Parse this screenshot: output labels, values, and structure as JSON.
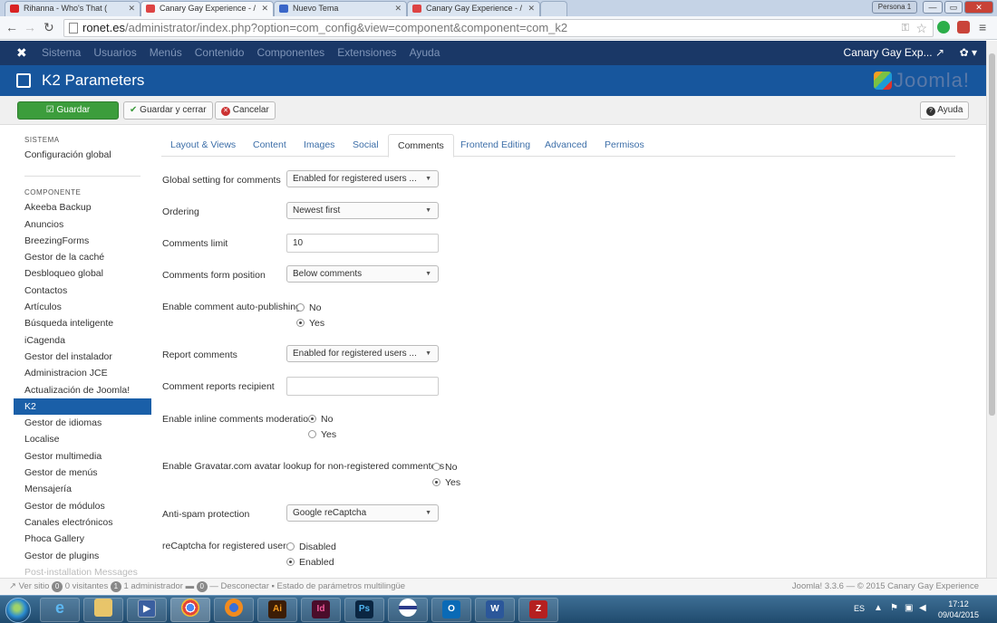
{
  "browser": {
    "tabs": [
      {
        "title": "Rihanna - Who's That (",
        "fav": "#d92323"
      },
      {
        "title": "Canary Gay Experience - /",
        "fav": "#d44"
      },
      {
        "title": "Nuevo Tema",
        "fav": "#3a66c8"
      },
      {
        "title": "Canary Gay Experience - /",
        "fav": "#d44"
      }
    ],
    "persona": "Persona 1",
    "url_domain": "ronet.es",
    "url_path": "/administrator/index.php?option=com_config&view=component&component=com_k2"
  },
  "joomla": {
    "menu": [
      "Sistema",
      "Usuarios",
      "Menús",
      "Contenido",
      "Componentes",
      "Extensiones",
      "Ayuda"
    ],
    "site_name": "Canary Gay Exp...",
    "page_title": "K2 Parameters",
    "logo_text": "Joomla!"
  },
  "toolbar": {
    "save": "Guardar",
    "save_close": "Guardar y cerrar",
    "cancel": "Cancelar",
    "help": "Ayuda"
  },
  "sidebar": {
    "system_header": "SISTEMA",
    "global_config": "Configuración global",
    "component_header": "COMPONENTE",
    "items": [
      "Akeeba Backup",
      "Anuncios",
      "BreezingForms",
      "Gestor de la caché",
      "Desbloqueo global",
      "Contactos",
      "Artículos",
      "Búsqueda inteligente",
      "iCagenda",
      "Gestor del instalador",
      "Administracion JCE",
      "Actualización de Joomla!",
      "K2",
      "Gestor de idiomas",
      "Localise",
      "Gestor multimedia",
      "Gestor de menús",
      "Mensajería",
      "Gestor de módulos",
      "Canales electrónicos",
      "Phoca Gallery",
      "Gestor de plugins",
      "Post-installation Messages"
    ],
    "active_item": "K2"
  },
  "tabs": [
    "Layout & Views",
    "Content",
    "Images",
    "Social",
    "Comments",
    "Frontend Editing",
    "Advanced",
    "Permisos"
  ],
  "active_tab": "Comments",
  "form": {
    "global_setting_label": "Global setting for comments",
    "global_setting_value": "Enabled for registered users ...",
    "ordering_label": "Ordering",
    "ordering_value": "Newest first",
    "limit_label": "Comments limit",
    "limit_value": "10",
    "form_position_label": "Comments form position",
    "form_position_value": "Below comments",
    "auto_publish_label": "Enable comment auto-publishing",
    "auto_publish_no": "No",
    "auto_publish_yes": "Yes",
    "report_label": "Report comments",
    "report_value": "Enabled for registered users ...",
    "recipient_label": "Comment reports recipient",
    "recipient_value": "",
    "inline_mod_label": "Enable inline comments moderation",
    "inline_mod_no": "No",
    "inline_mod_yes": "Yes",
    "gravatar_label": "Enable Gravatar.com avatar lookup for non-registered commenters",
    "gravatar_no": "No",
    "gravatar_yes": "Yes",
    "antispam_label": "Anti-spam protection",
    "antispam_value": "Google reCaptcha",
    "recaptcha_label": "reCaptcha for registered users",
    "recaptcha_disabled": "Disabled",
    "recaptcha_enabled": "Enabled"
  },
  "statusbar": {
    "view_site": "Ver sitio",
    "visitors_count": "0",
    "visitors_label": "0 visitantes",
    "admin_count": "1",
    "admin_label": "1 administrador",
    "msg_count": "0",
    "logout": "Desconectar",
    "multilang": "Estado de parámetros multilingüe",
    "copyright": "Joomla! 3.3.6 — © 2015 Canary Gay Experience"
  },
  "taskbar": {
    "lang": "ES",
    "time": "17:12",
    "date": "09/04/2015"
  }
}
